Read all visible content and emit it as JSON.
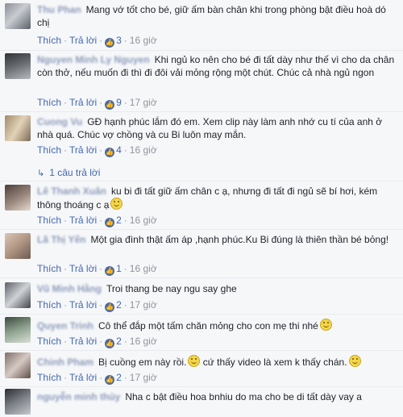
{
  "actions": {
    "like": "Thích",
    "reply": "Trả lời"
  },
  "comments": [
    {
      "name": "Thu Phan",
      "text": "Mang vớ tốt cho bé, giữ ấm bàn chân khi trong phòng bật điều hoà dó chị",
      "likes": "3",
      "time": "16 giờ",
      "emoji": false
    },
    {
      "name": "Nguyen Minh Ly Nguyen",
      "text": "Khi ngủ ko nên cho bé đi tất dày như thế vì cho da chân còn thở, nếu muốn đi thì đi đôi vải mỏng rộng một chút. Chúc cả nhà ngủ ngon",
      "likes": "9",
      "time": "17 giờ",
      "emoji": false
    },
    {
      "name": "Cuong Vu",
      "text": "GĐ hạnh phúc lắm đó em. Xem clip này làm anh nhớ cu tí của anh ở nhà quá. Chúc vợ chồng và cu Bi luôn may mắn.",
      "likes": "4",
      "time": "16 giờ",
      "emoji": false
    },
    {
      "name": "Lê Thanh Xuân",
      "text": "ku bi đi tất giữ ấm chân c ạ, nhưng đi tất đi ngủ sẽ bí hơi, kém thông thoáng c ạ",
      "likes": "",
      "time": "",
      "emoji": true
    },
    {
      "name": "Lã Thị Yến",
      "text": "Một gia đình thật ấm áp ,hạnh phúc.Ku Bi đúng là thiên thần bé bỏng!",
      "likes": "",
      "time": "",
      "emoji": false
    },
    {
      "name": "Vũ Minh Hằng",
      "text": "Troi thang be nay ngu say ghe",
      "likes": "2",
      "time": "17 giờ",
      "emoji": false
    },
    {
      "name": "Quyen Trinh",
      "text": "Cô thể đắp một tấm chăn mỏng cho con mẹ thi nhé",
      "likes": "2",
      "time": "16 giờ",
      "emoji": true
    },
    {
      "name": "Chinh Pham",
      "text": "Bị cuồng em này rồi.",
      "text2": " cứ thấy video là xem k thấy chán.",
      "likes": "2",
      "time": "17 giờ",
      "emoji": true
    },
    {
      "name": "nguyễn minh thủy",
      "text": "Nha c bật điều hoa bnhiu do ma cho be di tất dày vay a",
      "likes": "",
      "time": "",
      "emoji": false
    }
  ],
  "reply_summary": "1 câu trả lời"
}
